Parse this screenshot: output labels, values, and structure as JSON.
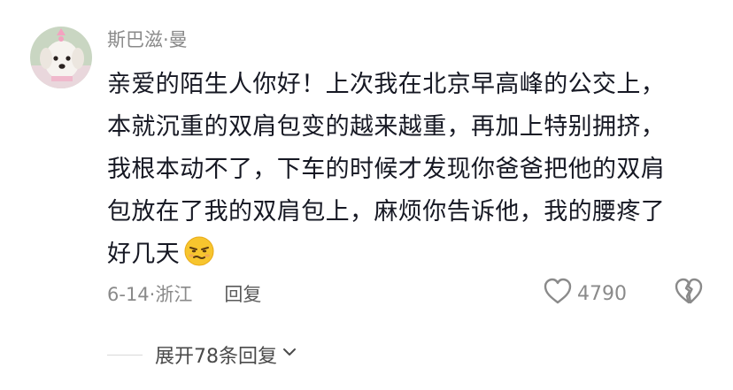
{
  "comment": {
    "username": "斯巴滋·曼",
    "text_lines": [
      "亲爱的陌生人你好！上次我在北京早高峰的公交上，",
      "本就沉重的双肩包变的越来越重，再加上特别拥挤，",
      "我根本动不了，下车的时候才发现你爸爸把他的双肩",
      "包放在了我的双肩包上，麻烦你告诉他，我的腰疼了",
      "好几天"
    ],
    "emoji": "annoyed-face-emoji",
    "date_location": "6-14·浙江",
    "reply_label": "回复",
    "like_count": "4790"
  },
  "replies": {
    "expand_label": "展开78条回复"
  },
  "colors": {
    "text": "#161823",
    "muted": "#8a8a8a",
    "emoji": "#f7c52e"
  }
}
